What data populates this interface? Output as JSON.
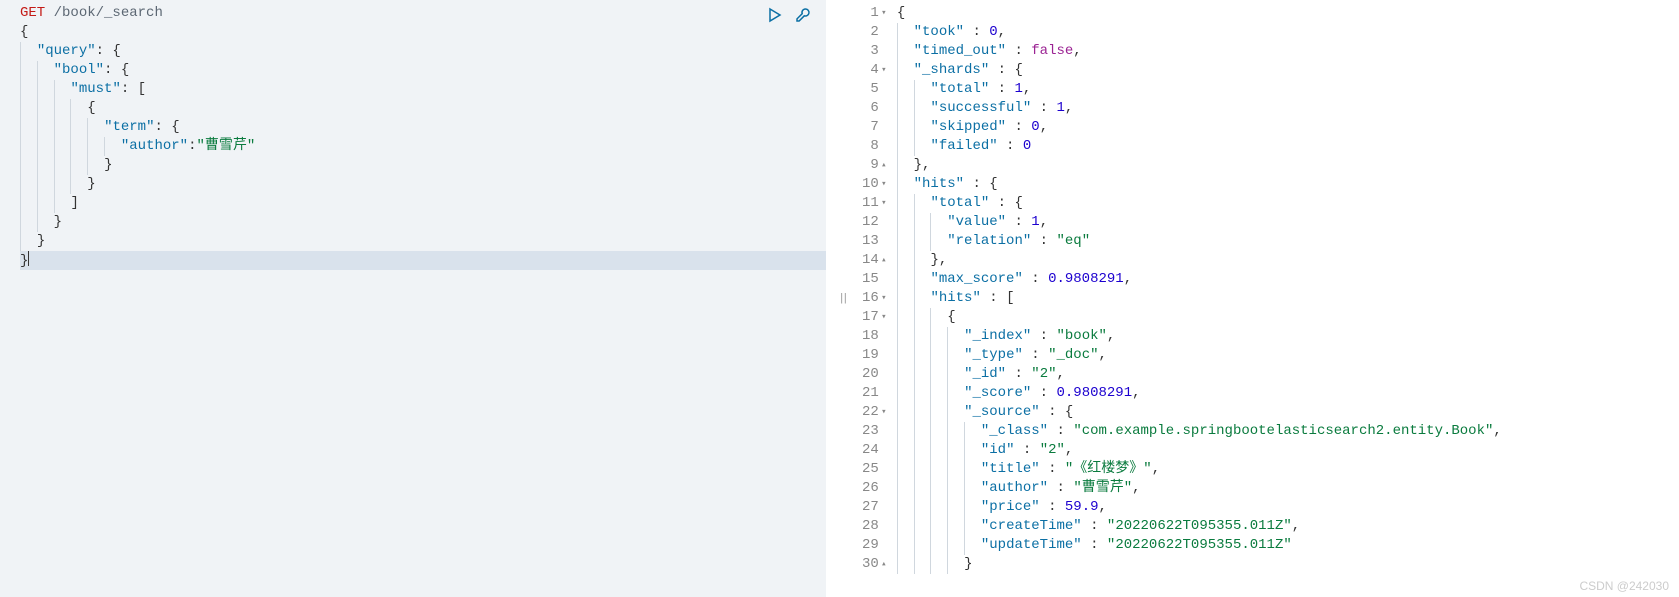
{
  "request": {
    "method": "GET",
    "path": "/book/_search",
    "body_lines": [
      {
        "indent": 0,
        "tokens": [
          {
            "t": "punct",
            "v": "{"
          }
        ]
      },
      {
        "indent": 1,
        "tokens": [
          {
            "t": "key",
            "v": "\"query\""
          },
          {
            "t": "punct",
            "v": ": {"
          }
        ]
      },
      {
        "indent": 2,
        "tokens": [
          {
            "t": "key",
            "v": "\"bool\""
          },
          {
            "t": "punct",
            "v": ": {"
          }
        ]
      },
      {
        "indent": 3,
        "tokens": [
          {
            "t": "key",
            "v": "\"must\""
          },
          {
            "t": "punct",
            "v": ": ["
          }
        ]
      },
      {
        "indent": 4,
        "tokens": [
          {
            "t": "punct",
            "v": "{"
          }
        ]
      },
      {
        "indent": 5,
        "tokens": [
          {
            "t": "key",
            "v": "\"term\""
          },
          {
            "t": "punct",
            "v": ": {"
          }
        ]
      },
      {
        "indent": 6,
        "tokens": [
          {
            "t": "key",
            "v": "\"author\""
          },
          {
            "t": "punct",
            "v": ":"
          },
          {
            "t": "string",
            "v": "\"曹雪芹\""
          }
        ]
      },
      {
        "indent": 5,
        "tokens": [
          {
            "t": "punct",
            "v": "}"
          }
        ]
      },
      {
        "indent": 4,
        "tokens": [
          {
            "t": "punct",
            "v": "}"
          }
        ]
      },
      {
        "indent": 3,
        "tokens": [
          {
            "t": "punct",
            "v": "]"
          }
        ]
      },
      {
        "indent": 2,
        "tokens": [
          {
            "t": "punct",
            "v": "}"
          }
        ]
      },
      {
        "indent": 1,
        "tokens": [
          {
            "t": "punct",
            "v": "}"
          }
        ]
      },
      {
        "indent": 0,
        "tokens": [
          {
            "t": "punct",
            "v": "}"
          }
        ],
        "cursor": true
      }
    ]
  },
  "response_lines": [
    {
      "num": "1",
      "fold": "▾",
      "indent": 0,
      "tokens": [
        {
          "t": "punct",
          "v": "{"
        }
      ]
    },
    {
      "num": "2",
      "fold": "",
      "indent": 1,
      "tokens": [
        {
          "t": "key",
          "v": "\"took\""
        },
        {
          "t": "punct",
          "v": " : "
        },
        {
          "t": "number",
          "v": "0"
        },
        {
          "t": "punct",
          "v": ","
        }
      ]
    },
    {
      "num": "3",
      "fold": "",
      "indent": 1,
      "tokens": [
        {
          "t": "key",
          "v": "\"timed_out\""
        },
        {
          "t": "punct",
          "v": " : "
        },
        {
          "t": "bool",
          "v": "false"
        },
        {
          "t": "punct",
          "v": ","
        }
      ]
    },
    {
      "num": "4",
      "fold": "▾",
      "indent": 1,
      "tokens": [
        {
          "t": "key",
          "v": "\"_shards\""
        },
        {
          "t": "punct",
          "v": " : {"
        }
      ]
    },
    {
      "num": "5",
      "fold": "",
      "indent": 2,
      "tokens": [
        {
          "t": "key",
          "v": "\"total\""
        },
        {
          "t": "punct",
          "v": " : "
        },
        {
          "t": "number",
          "v": "1"
        },
        {
          "t": "punct",
          "v": ","
        }
      ]
    },
    {
      "num": "6",
      "fold": "",
      "indent": 2,
      "tokens": [
        {
          "t": "key",
          "v": "\"successful\""
        },
        {
          "t": "punct",
          "v": " : "
        },
        {
          "t": "number",
          "v": "1"
        },
        {
          "t": "punct",
          "v": ","
        }
      ]
    },
    {
      "num": "7",
      "fold": "",
      "indent": 2,
      "tokens": [
        {
          "t": "key",
          "v": "\"skipped\""
        },
        {
          "t": "punct",
          "v": " : "
        },
        {
          "t": "number",
          "v": "0"
        },
        {
          "t": "punct",
          "v": ","
        }
      ]
    },
    {
      "num": "8",
      "fold": "",
      "indent": 2,
      "tokens": [
        {
          "t": "key",
          "v": "\"failed\""
        },
        {
          "t": "punct",
          "v": " : "
        },
        {
          "t": "number",
          "v": "0"
        }
      ]
    },
    {
      "num": "9",
      "fold": "▴",
      "indent": 1,
      "tokens": [
        {
          "t": "punct",
          "v": "},"
        }
      ]
    },
    {
      "num": "10",
      "fold": "▾",
      "indent": 1,
      "tokens": [
        {
          "t": "key",
          "v": "\"hits\""
        },
        {
          "t": "punct",
          "v": " : {"
        }
      ]
    },
    {
      "num": "11",
      "fold": "▾",
      "indent": 2,
      "tokens": [
        {
          "t": "key",
          "v": "\"total\""
        },
        {
          "t": "punct",
          "v": " : {"
        }
      ]
    },
    {
      "num": "12",
      "fold": "",
      "indent": 3,
      "tokens": [
        {
          "t": "key",
          "v": "\"value\""
        },
        {
          "t": "punct",
          "v": " : "
        },
        {
          "t": "number",
          "v": "1"
        },
        {
          "t": "punct",
          "v": ","
        }
      ]
    },
    {
      "num": "13",
      "fold": "",
      "indent": 3,
      "tokens": [
        {
          "t": "key",
          "v": "\"relation\""
        },
        {
          "t": "punct",
          "v": " : "
        },
        {
          "t": "string",
          "v": "\"eq\""
        }
      ]
    },
    {
      "num": "14",
      "fold": "▴",
      "indent": 2,
      "tokens": [
        {
          "t": "punct",
          "v": "},"
        }
      ]
    },
    {
      "num": "15",
      "fold": "",
      "indent": 2,
      "tokens": [
        {
          "t": "key",
          "v": "\"max_score\""
        },
        {
          "t": "punct",
          "v": " : "
        },
        {
          "t": "number",
          "v": "0.9808291"
        },
        {
          "t": "punct",
          "v": ","
        }
      ]
    },
    {
      "num": "16",
      "fold": "▾",
      "indent": 2,
      "tokens": [
        {
          "t": "key",
          "v": "\"hits\""
        },
        {
          "t": "punct",
          "v": " : ["
        }
      ]
    },
    {
      "num": "17",
      "fold": "▾",
      "indent": 3,
      "tokens": [
        {
          "t": "punct",
          "v": "{"
        }
      ]
    },
    {
      "num": "18",
      "fold": "",
      "indent": 4,
      "tokens": [
        {
          "t": "key",
          "v": "\"_index\""
        },
        {
          "t": "punct",
          "v": " : "
        },
        {
          "t": "string",
          "v": "\"book\""
        },
        {
          "t": "punct",
          "v": ","
        }
      ]
    },
    {
      "num": "19",
      "fold": "",
      "indent": 4,
      "tokens": [
        {
          "t": "key",
          "v": "\"_type\""
        },
        {
          "t": "punct",
          "v": " : "
        },
        {
          "t": "string",
          "v": "\"_doc\""
        },
        {
          "t": "punct",
          "v": ","
        }
      ]
    },
    {
      "num": "20",
      "fold": "",
      "indent": 4,
      "tokens": [
        {
          "t": "key",
          "v": "\"_id\""
        },
        {
          "t": "punct",
          "v": " : "
        },
        {
          "t": "string",
          "v": "\"2\""
        },
        {
          "t": "punct",
          "v": ","
        }
      ]
    },
    {
      "num": "21",
      "fold": "",
      "indent": 4,
      "tokens": [
        {
          "t": "key",
          "v": "\"_score\""
        },
        {
          "t": "punct",
          "v": " : "
        },
        {
          "t": "number",
          "v": "0.9808291"
        },
        {
          "t": "punct",
          "v": ","
        }
      ]
    },
    {
      "num": "22",
      "fold": "▾",
      "indent": 4,
      "tokens": [
        {
          "t": "key",
          "v": "\"_source\""
        },
        {
          "t": "punct",
          "v": " : {"
        }
      ]
    },
    {
      "num": "23",
      "fold": "",
      "indent": 5,
      "tokens": [
        {
          "t": "key",
          "v": "\"_class\""
        },
        {
          "t": "punct",
          "v": " : "
        },
        {
          "t": "string",
          "v": "\"com.example.springbootelasticsearch2.entity.Book\""
        },
        {
          "t": "punct",
          "v": ","
        }
      ]
    },
    {
      "num": "24",
      "fold": "",
      "indent": 5,
      "tokens": [
        {
          "t": "key",
          "v": "\"id\""
        },
        {
          "t": "punct",
          "v": " : "
        },
        {
          "t": "string",
          "v": "\"2\""
        },
        {
          "t": "punct",
          "v": ","
        }
      ]
    },
    {
      "num": "25",
      "fold": "",
      "indent": 5,
      "tokens": [
        {
          "t": "key",
          "v": "\"title\""
        },
        {
          "t": "punct",
          "v": " : "
        },
        {
          "t": "string",
          "v": "\"《红楼梦》\""
        },
        {
          "t": "punct",
          "v": ","
        }
      ]
    },
    {
      "num": "26",
      "fold": "",
      "indent": 5,
      "tokens": [
        {
          "t": "key",
          "v": "\"author\""
        },
        {
          "t": "punct",
          "v": " : "
        },
        {
          "t": "string",
          "v": "\"曹雪芹\""
        },
        {
          "t": "punct",
          "v": ","
        }
      ]
    },
    {
      "num": "27",
      "fold": "",
      "indent": 5,
      "tokens": [
        {
          "t": "key",
          "v": "\"price\""
        },
        {
          "t": "punct",
          "v": " : "
        },
        {
          "t": "number",
          "v": "59.9"
        },
        {
          "t": "punct",
          "v": ","
        }
      ]
    },
    {
      "num": "28",
      "fold": "",
      "indent": 5,
      "tokens": [
        {
          "t": "key",
          "v": "\"createTime\""
        },
        {
          "t": "punct",
          "v": " : "
        },
        {
          "t": "string",
          "v": "\"20220622T095355.011Z\""
        },
        {
          "t": "punct",
          "v": ","
        }
      ]
    },
    {
      "num": "29",
      "fold": "",
      "indent": 5,
      "tokens": [
        {
          "t": "key",
          "v": "\"updateTime\""
        },
        {
          "t": "punct",
          "v": " : "
        },
        {
          "t": "string",
          "v": "\"20220622T095355.011Z\""
        }
      ]
    },
    {
      "num": "30",
      "fold": "▴",
      "indent": 4,
      "tokens": [
        {
          "t": "punct",
          "v": "}"
        }
      ]
    }
  ],
  "watermark": "CSDN @242030"
}
